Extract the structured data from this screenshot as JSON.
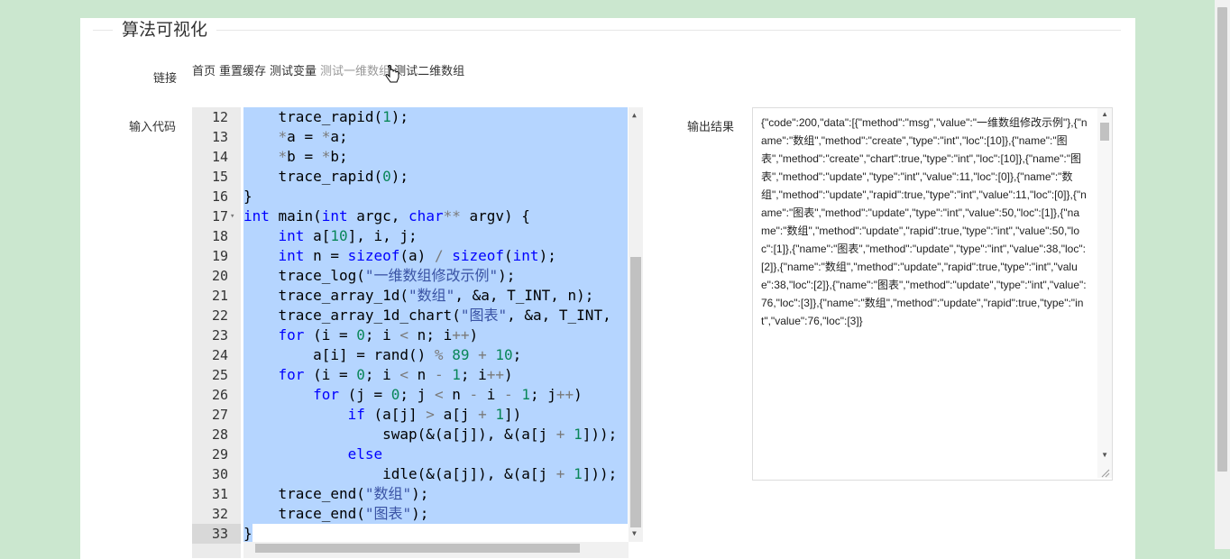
{
  "header": {
    "title": "算法可视化"
  },
  "labels": {
    "links": "链接",
    "input": "输入代码",
    "output": "输出结果"
  },
  "links": [
    "首页",
    "重置缓存",
    "测试变量",
    "测试一维数组",
    "测试二维数组"
  ],
  "editor": {
    "lines": [
      {
        "n": "12",
        "code": "    trace_rapid(1);"
      },
      {
        "n": "13",
        "code": "    *a = *a;"
      },
      {
        "n": "14",
        "code": "    *b = *b;"
      },
      {
        "n": "15",
        "code": "    trace_rapid(0);"
      },
      {
        "n": "16",
        "code": "}"
      },
      {
        "n": "17",
        "code": "int main(int argc, char** argv) {"
      },
      {
        "n": "18",
        "code": "    int a[10], i, j;"
      },
      {
        "n": "19",
        "code": "    int n = sizeof(a) / sizeof(int);"
      },
      {
        "n": "20",
        "code": "    trace_log(\"一维数组修改示例\");"
      },
      {
        "n": "21",
        "code": "    trace_array_1d(\"数组\", &a, T_INT, n);"
      },
      {
        "n": "22",
        "code": "    trace_array_1d_chart(\"图表\", &a, T_INT,"
      },
      {
        "n": "23",
        "code": "    for (i = 0; i < n; i++)"
      },
      {
        "n": "24",
        "code": "        a[i] = rand() % 89 + 10;"
      },
      {
        "n": "25",
        "code": "    for (i = 0; i < n - 1; i++)"
      },
      {
        "n": "26",
        "code": "        for (j = 0; j < n - i - 1; j++)"
      },
      {
        "n": "27",
        "code": "            if (a[j] > a[j + 1])"
      },
      {
        "n": "28",
        "code": "                swap(&(a[j]), &(a[j + 1]));"
      },
      {
        "n": "29",
        "code": "            else"
      },
      {
        "n": "30",
        "code": "                idle(&(a[j]), &(a[j + 1]));"
      },
      {
        "n": "31",
        "code": "    trace_end(\"数组\");"
      },
      {
        "n": "32",
        "code": "    trace_end(\"图表\");"
      },
      {
        "n": "33",
        "code": "}"
      }
    ]
  },
  "output": {
    "text": "{\"code\":200,\"data\":[{\"method\":\"msg\",\"value\":\"一维数组修改示例\"},{\"name\":\"数组\",\"method\":\"create\",\"type\":\"int\",\"loc\":[10]},{\"name\":\"图表\",\"method\":\"create\",\"chart\":true,\"type\":\"int\",\"loc\":[10]},{\"name\":\"图表\",\"method\":\"update\",\"type\":\"int\",\"value\":11,\"loc\":[0]},{\"name\":\"数组\",\"method\":\"update\",\"rapid\":true,\"type\":\"int\",\"value\":11,\"loc\":[0]},{\"name\":\"图表\",\"method\":\"update\",\"type\":\"int\",\"value\":50,\"loc\":[1]},{\"name\":\"数组\",\"method\":\"update\",\"rapid\":true,\"type\":\"int\",\"value\":50,\"loc\":[1]},{\"name\":\"图表\",\"method\":\"update\",\"type\":\"int\",\"value\":38,\"loc\":[2]},{\"name\":\"数组\",\"method\":\"update\",\"rapid\":true,\"type\":\"int\",\"value\":38,\"loc\":[2]},{\"name\":\"图表\",\"method\":\"update\",\"type\":\"int\",\"value\":76,\"loc\":[3]},{\"name\":\"数组\",\"method\":\"update\",\"rapid\":true,\"type\":\"int\",\"value\":76,\"loc\":[3]}"
  }
}
